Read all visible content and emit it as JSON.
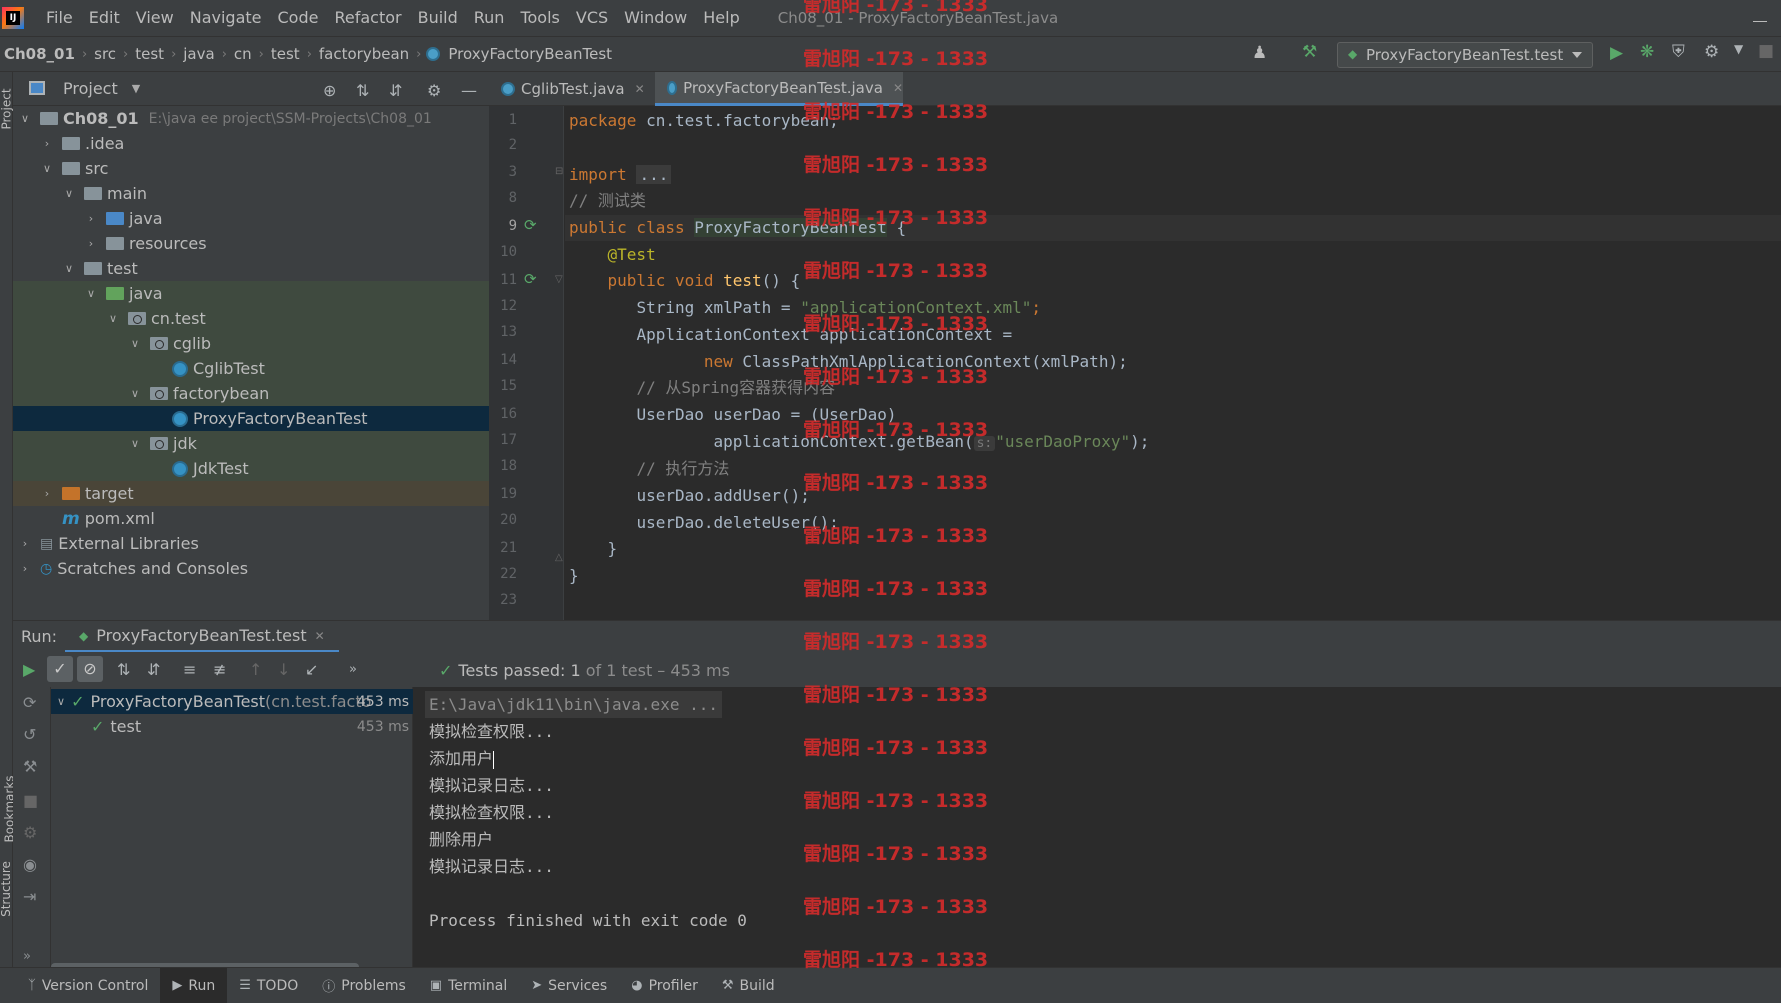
{
  "menubar": {
    "items": [
      "File",
      "Edit",
      "View",
      "Navigate",
      "Code",
      "Refactor",
      "Build",
      "Run",
      "Tools",
      "VCS",
      "Window",
      "Help"
    ],
    "window_title": "Ch08_01 - ProxyFactoryBeanTest.java"
  },
  "breadcrumbs": [
    "Ch08_01",
    "src",
    "test",
    "java",
    "cn",
    "test",
    "factorybean",
    "ProxyFactoryBeanTest"
  ],
  "toolbar": {
    "run_config": "ProxyFactoryBeanTest.test"
  },
  "project_panel": {
    "title": "Project",
    "tree": [
      {
        "label": "Ch08_01",
        "hint": "E:\\java ee project\\SSM-Projects\\Ch08_01"
      },
      {
        "label": ".idea"
      },
      {
        "label": "src"
      },
      {
        "label": "main"
      },
      {
        "label": "java"
      },
      {
        "label": "resources"
      },
      {
        "label": "test"
      },
      {
        "label": "java"
      },
      {
        "label": "cn.test"
      },
      {
        "label": "cglib"
      },
      {
        "label": "CglibTest"
      },
      {
        "label": "factorybean"
      },
      {
        "label": "ProxyFactoryBeanTest"
      },
      {
        "label": "jdk"
      },
      {
        "label": "JdkTest"
      },
      {
        "label": "target"
      },
      {
        "label": "pom.xml"
      },
      {
        "label": "External Libraries"
      },
      {
        "label": "Scratches and Consoles"
      }
    ]
  },
  "side_labels": {
    "project": "Project",
    "bookmarks": "Bookmarks",
    "structure": "Structure"
  },
  "editor": {
    "tabs": [
      {
        "label": "CglibTest.java"
      },
      {
        "label": "ProxyFactoryBeanTest.java"
      }
    ],
    "line_numbers": [
      "1",
      "2",
      "3",
      "8",
      "9",
      "10",
      "11",
      "12",
      "13",
      "14",
      "15",
      "16",
      "17",
      "18",
      "19",
      "20",
      "21",
      "22",
      "23"
    ],
    "code": {
      "l1_kw": "package",
      "l1_rest": " cn.test.factorybean;",
      "l3_kw": "import",
      "l3_folded": "...",
      "l8_cmt": "// 测试类",
      "l9_kw": "public class",
      "l9_cls": "ProxyFactoryBeanTest",
      "l9_rest": " {",
      "l10_ann": "@Test",
      "l11_kw": "public void",
      "l11_fn": "test",
      "l11_rest": "() {",
      "l12_a": "String xmlPath = ",
      "l12_str": "\"applicationContext.xml\"",
      "l12_b": ";",
      "l13": "ApplicationContext applicationContext =",
      "l14_kw": "new",
      "l14_rest": " ClassPathXmlApplicationContext(xmlPath);",
      "l15_cmt": "// 从Spring容器获得内容",
      "l16": "UserDao userDao = (UserDao)",
      "l17_a": "applicationContext.getBean(",
      "l17_hint": "s:",
      "l17_str": "\"userDaoProxy\"",
      "l17_b": ");",
      "l18_cmt": "// 执行方法",
      "l19": "userDao.addUser();",
      "l20": "userDao.deleteUser();",
      "l21": "}",
      "l22": "}"
    }
  },
  "watermark": "雷旭阳 -173 - 1333",
  "run_panel": {
    "label": "Run:",
    "tab": "ProxyFactoryBeanTest.test",
    "status_strong": "Tests passed: 1",
    "status_muted": " of 1 test – 453 ms",
    "tree": [
      {
        "label": "ProxyFactoryBeanTest",
        "sub": " (cn.test.facto",
        "time": "453 ms"
      },
      {
        "label": "test",
        "time": "453 ms"
      }
    ],
    "console": [
      "E:\\Java\\jdk11\\bin\\java.exe ...",
      "模拟检查权限...",
      "添加用户",
      "模拟记录日志...",
      "模拟检查权限...",
      "删除用户",
      "模拟记录日志...",
      "",
      "Process finished with exit code 0"
    ]
  },
  "status_bar": {
    "items": [
      "Version Control",
      "Run",
      "TODO",
      "Problems",
      "Terminal",
      "Services",
      "Profiler",
      "Build"
    ]
  },
  "colors": {
    "accent": "#4a88c7",
    "pass": "#59a869",
    "watermark": "#d22b2b"
  }
}
